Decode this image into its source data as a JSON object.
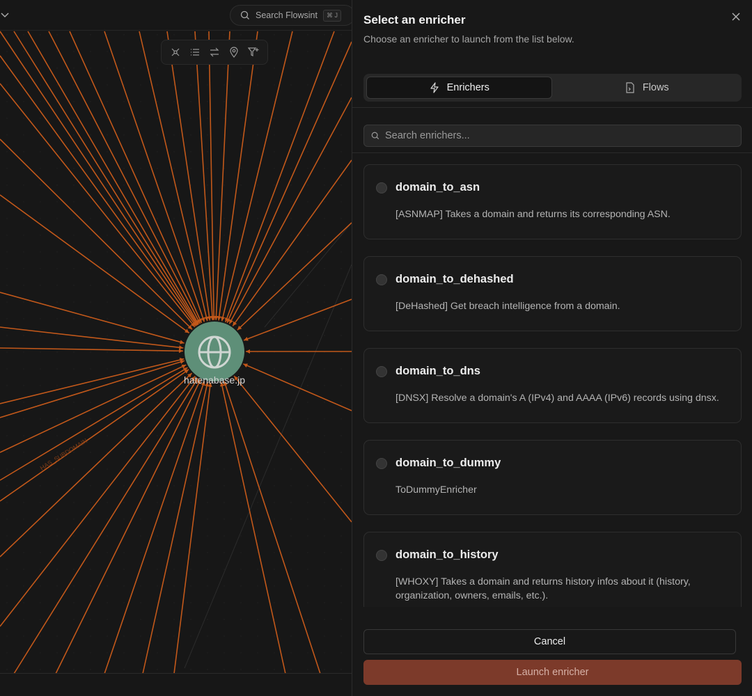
{
  "graph": {
    "search_label": "Search Flowsint",
    "search_shortcut": "⌘ J",
    "node_label": "hatenabase.jp",
    "edge_label": "HAS_SUBDOMAIN",
    "toolbar_icons": [
      "network-icon",
      "list-icon",
      "swap-icon",
      "map-pin-icon",
      "filter-plus-icon"
    ],
    "edge_color": "#c2581a",
    "node_color": "#5e8f78"
  },
  "panel": {
    "title": "Select an enricher",
    "subtitle": "Choose an enricher to launch from the list below.",
    "tabs": [
      {
        "label": "Enrichers",
        "icon": "zap-icon",
        "active": true
      },
      {
        "label": "Flows",
        "icon": "file-flow-icon",
        "active": false
      }
    ],
    "search_placeholder": "Search enrichers...",
    "enrichers": [
      {
        "name": "domain_to_asn",
        "description": "[ASNMAP] Takes a domain and returns its corresponding ASN."
      },
      {
        "name": "domain_to_dehashed",
        "description": "[DeHashed] Get breach intelligence from a domain."
      },
      {
        "name": "domain_to_dns",
        "description": "[DNSX] Resolve a domain's A (IPv4) and AAAA (IPv6) records using dnsx."
      },
      {
        "name": "domain_to_dummy",
        "description": "ToDummyEnricher"
      },
      {
        "name": "domain_to_history",
        "description": "[WHOXY] Takes a domain and returns history infos about it (history, organization, owners, emails, etc.)."
      }
    ],
    "cancel_label": "Cancel",
    "launch_label": "Launch enricher",
    "accent_color": "#7c3a2a"
  }
}
